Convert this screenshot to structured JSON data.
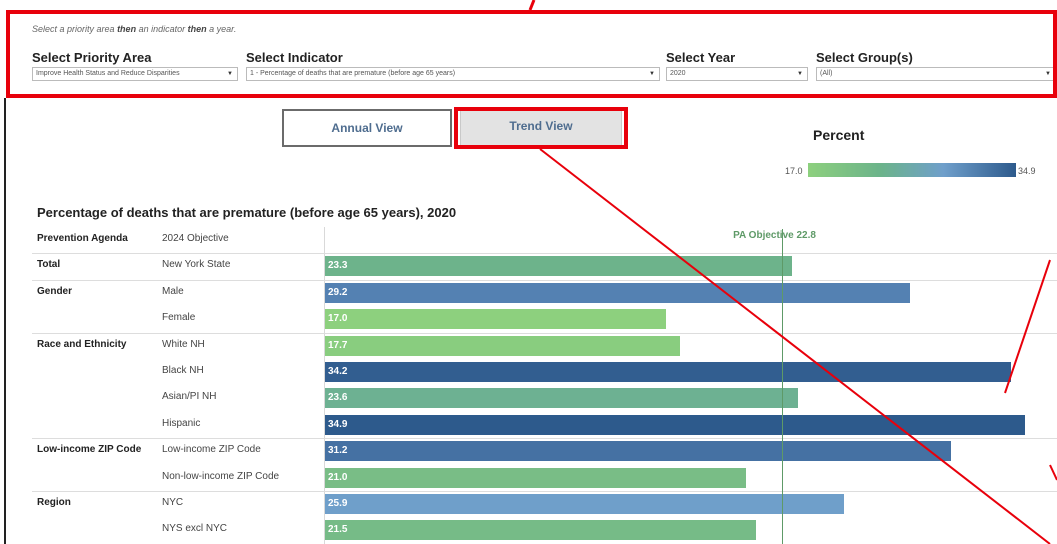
{
  "instruction": {
    "prefix": "Select a priority area",
    "then1": "then",
    "mid": "an indicator",
    "then2": "then",
    "suffix": "a year."
  },
  "filters": [
    {
      "label": "Select Priority Area",
      "value": "Improve Health Status and Reduce Disparities"
    },
    {
      "label": "Select Indicator",
      "value": "1 - Percentage of deaths that are premature (before age 65 years)"
    },
    {
      "label": "Select Year",
      "value": "2020"
    },
    {
      "label": "Select Group(s)",
      "value": "(All)"
    }
  ],
  "views": {
    "annual": "Annual View",
    "trend": "Trend View"
  },
  "legend": {
    "title": "Percent",
    "min": "17.0",
    "max": "34.9"
  },
  "chart_data": {
    "type": "bar",
    "title": "Percentage of deaths that are premature (before age 65 years), 2020",
    "objective": {
      "label": "PA Objective 22.8",
      "value": 22.8
    },
    "scale": {
      "min": 17.0,
      "max": 34.9
    },
    "rows": [
      {
        "group": "Prevention Agenda",
        "label": "2024 Objective",
        "value": null,
        "display": ""
      },
      {
        "group": "Total",
        "label": "New York State",
        "value": 23.3,
        "display": "23.3"
      },
      {
        "group": "Gender",
        "label": "Male",
        "value": 29.2,
        "display": "29.2"
      },
      {
        "group": "",
        "label": "Female",
        "value": 17.0,
        "display": "17.0"
      },
      {
        "group": "Race and Ethnicity",
        "label": "White NH",
        "value": 17.7,
        "display": "17.7"
      },
      {
        "group": "",
        "label": "Black NH",
        "value": 34.2,
        "display": "34.2"
      },
      {
        "group": "",
        "label": "Asian/PI NH",
        "value": 23.6,
        "display": "23.6"
      },
      {
        "group": "",
        "label": "Hispanic",
        "value": 34.9,
        "display": "34.9"
      },
      {
        "group": "Low-income ZIP Code",
        "label": "Low-income ZIP Code",
        "value": 31.2,
        "display": "31.2"
      },
      {
        "group": "",
        "label": "Non-low-income ZIP Code",
        "value": 21.0,
        "display": "21.0"
      },
      {
        "group": "Region",
        "label": "NYC",
        "value": 25.9,
        "display": "25.9"
      },
      {
        "group": "",
        "label": "NYS excl NYC",
        "value": 21.5,
        "display": "21.5"
      }
    ]
  }
}
